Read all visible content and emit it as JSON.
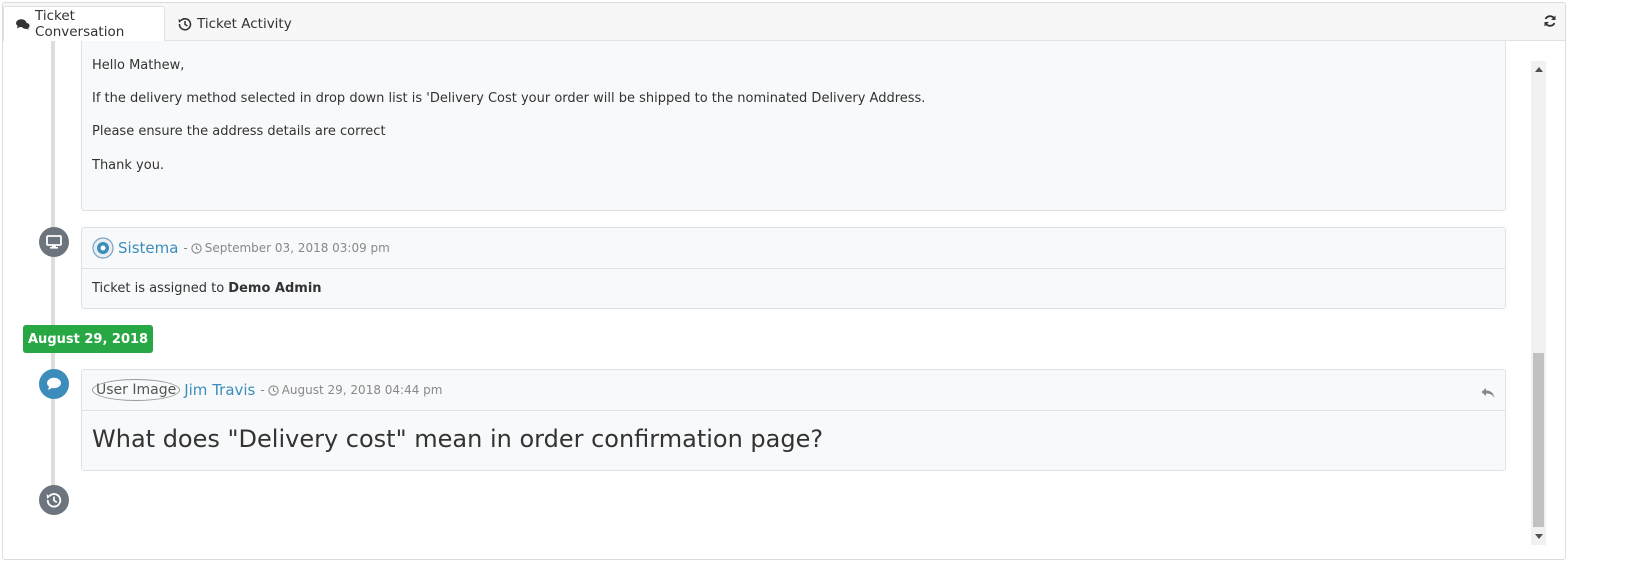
{
  "tabs": [
    {
      "label": "Ticket Conversation",
      "active": true,
      "icon": "comments-icon"
    },
    {
      "label": "Ticket Activity",
      "active": false,
      "icon": "history-icon"
    }
  ],
  "refresh_icon": "refresh-icon",
  "message1": {
    "lines": [
      "Hello Mathew,",
      "If the delivery method selected in drop down list is 'Delivery Cost your order will be shipped to the nominated Delivery Address.",
      "Please ensure the address details are correct",
      "Thank you."
    ]
  },
  "system_event": {
    "author": "Sistema",
    "separator": "-",
    "timestamp": "September 03, 2018 03:09 pm",
    "text_prefix": "Ticket is assigned to ",
    "text_bold": "Demo Admin"
  },
  "date_badge": "August 29, 2018",
  "message2": {
    "user_image_alt": "User Image",
    "author": "Jim Travis",
    "separator": "-",
    "timestamp": "August 29, 2018 04:44 pm",
    "subject": "What does \"Delivery cost\" mean in order confirmation page?"
  },
  "colors": {
    "accent": "#3c8dbc",
    "badge_green": "#28a745",
    "icon_gray": "#6c757d",
    "icon_blue": "#3c8dbc"
  }
}
